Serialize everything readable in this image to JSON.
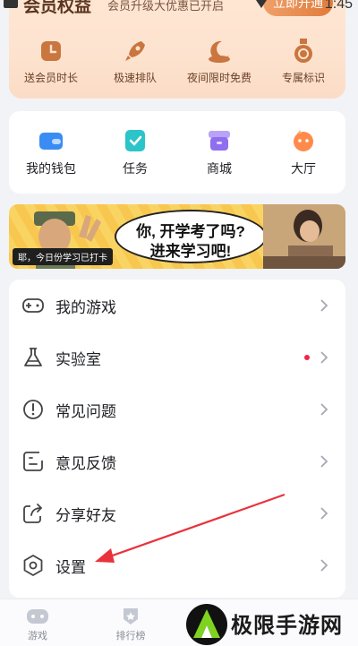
{
  "status": {
    "time": "1:45"
  },
  "vip": {
    "title": "会员权益",
    "subtitle": "会员升级大优惠已开启",
    "button": "立即开通",
    "perks": [
      {
        "label": "送会员时长",
        "icon": "clock-icon"
      },
      {
        "label": "极速排队",
        "icon": "rocket-icon"
      },
      {
        "label": "夜间限时免费",
        "icon": "moon-icon"
      },
      {
        "label": "专属标识",
        "icon": "medal-icon"
      }
    ],
    "colors": {
      "perk_icon": "#c9763f",
      "card_bg": "#fde3cf"
    }
  },
  "quick": [
    {
      "label": "我的钱包",
      "icon": "wallet-icon",
      "color": "#3a8cf5"
    },
    {
      "label": "任务",
      "icon": "task-icon",
      "color": "#2bc4c8"
    },
    {
      "label": "商城",
      "icon": "shop-icon",
      "color": "#8f6ef0"
    },
    {
      "label": "大厅",
      "icon": "lobby-icon",
      "color": "#ff8a4c"
    }
  ],
  "banner": {
    "line1": "你, 开学考了吗?",
    "line2": "进来学习吧!",
    "caption": "耶，今日份学习已打卡"
  },
  "menu": [
    {
      "label": "我的游戏",
      "icon": "gamepad-icon"
    },
    {
      "label": "实验室",
      "icon": "flask-icon",
      "dot": true
    },
    {
      "label": "常见问题",
      "icon": "alert-circle-icon"
    },
    {
      "label": "意见反馈",
      "icon": "feedback-icon"
    },
    {
      "label": "分享好友",
      "icon": "share-icon"
    },
    {
      "label": "设置",
      "icon": "settings-icon"
    }
  ],
  "tabs": [
    {
      "label": "游戏",
      "icon": "gamepad-tab-icon"
    },
    {
      "label": "排行榜",
      "icon": "ranking-icon"
    }
  ],
  "watermark": {
    "text": "极限手游网"
  },
  "colors": {
    "accent_red": "#e8323c",
    "dot": "#f0264a"
  }
}
